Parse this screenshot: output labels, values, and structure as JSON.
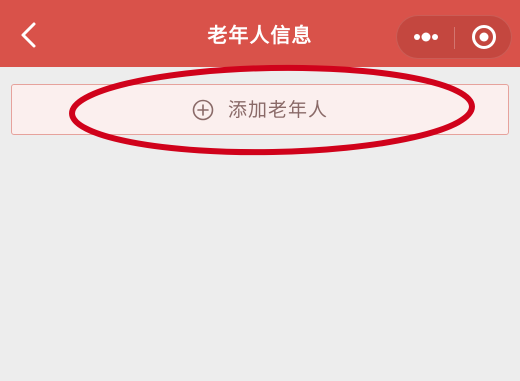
{
  "navbar": {
    "title": "老年人信息",
    "back_icon": "chevron-left-icon",
    "more_icon": "more-dots-icon",
    "close_icon": "target-circle-icon",
    "background_color": "#d9524a"
  },
  "main": {
    "add_button_label": "添加老年人",
    "add_icon": "plus-circle-icon"
  },
  "annotation": {
    "color": "#d0021b",
    "shape": "ellipse"
  }
}
